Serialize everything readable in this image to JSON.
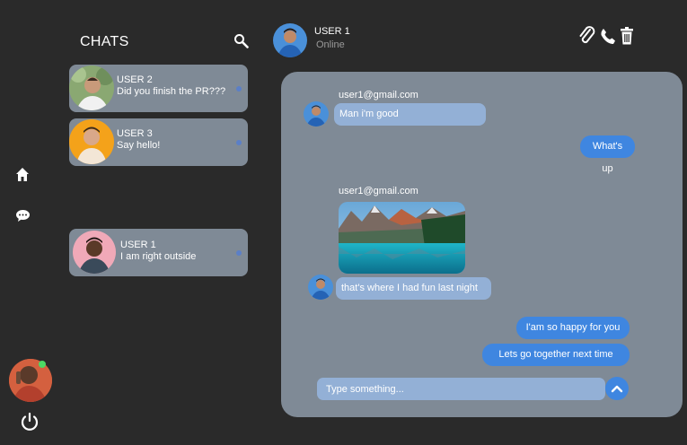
{
  "sidebar": {
    "icons": [
      "home-icon",
      "chat-bubble-icon",
      "power-icon"
    ]
  },
  "chats": {
    "title": "CHATS",
    "items": [
      {
        "name": "USER 2",
        "last_message": "Did you finish the PR???"
      },
      {
        "name": "USER 3",
        "last_message": "Say hello!"
      },
      {
        "name": "USER 1",
        "last_message": "I am right outside"
      }
    ]
  },
  "header": {
    "name": "USER 1",
    "status": "Online"
  },
  "conversation": {
    "messages": [
      {
        "direction": "in",
        "sender": "user1@gmail.com",
        "text": "Man i'm good"
      },
      {
        "direction": "out",
        "text": "What's up"
      },
      {
        "direction": "in",
        "sender": "user1@gmail.com",
        "image": "mountain-lake-photo",
        "text": "that's where I had fun last night"
      },
      {
        "direction": "out",
        "text": "I'am so happy for you"
      },
      {
        "direction": "out",
        "text": "Lets go together next time"
      }
    ]
  },
  "composer": {
    "placeholder": "Type something..."
  },
  "colors": {
    "background": "#2a2a2a",
    "panel": "#7f8a96",
    "incoming_bubble": "#93b0d6",
    "outgoing_bubble": "#3f86e0",
    "online": "#4cd964"
  }
}
